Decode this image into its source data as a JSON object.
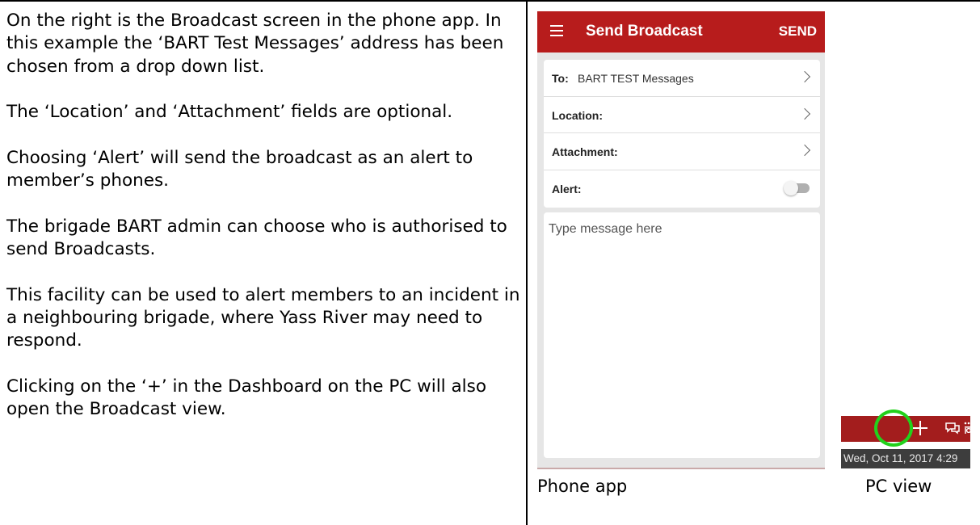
{
  "left_column": {
    "paragraphs": [
      "On the right is the Broadcast screen in the phone app. In this example the ‘BART Test Messages’ address has been chosen from a drop down list.",
      "The ‘Location’ and ‘Attachment’ fields are optional.",
      "Choosing ‘Alert’ will send the broadcast as an alert to member’s phones.",
      "The brigade BART admin can choose who is authorised to send Broadcasts.",
      "This facility can be used to alert members to an incident in a neighbouring brigade, where Yass River may need to respond.",
      "Clicking on the ‘+’ in the Dashboard on the PC will also open the Broadcast view."
    ]
  },
  "phone_app": {
    "app_bar": {
      "menu_icon": "hamburger-menu-icon",
      "title": "Send Broadcast",
      "send_label": "SEND",
      "color": "#b71c1c"
    },
    "form": {
      "to": {
        "label": "To:",
        "value": "BART TEST Messages",
        "icon": "chevron-right-icon"
      },
      "location": {
        "label": "Location:",
        "icon": "chevron-right-icon"
      },
      "attachment": {
        "label": "Attachment:",
        "icon": "chevron-right-icon"
      },
      "alert": {
        "label": "Alert:",
        "toggle_on": false
      }
    },
    "message": {
      "placeholder": "Type message here",
      "value": ""
    },
    "caption": "Phone app"
  },
  "pc_view": {
    "toolbar_icons": [
      "plus-icon",
      "chat-icon",
      "people-icon"
    ],
    "toolbar_color": "#a31d1d",
    "highlight_color": "#22d11c",
    "datetime": "Wed, Oct 11, 2017 4:29",
    "caption": "PC view"
  }
}
